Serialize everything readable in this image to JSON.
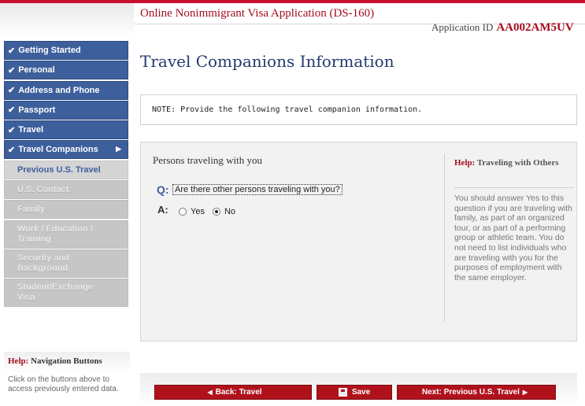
{
  "header": {
    "title": "Online Nonimmigrant Visa Application (DS-160)",
    "app_id_label": "Application ID",
    "app_id": "AA002AM5UV"
  },
  "page_title": "Travel Companions Information",
  "sidebar": {
    "items": [
      {
        "label": "Getting Started",
        "state": "done"
      },
      {
        "label": "Personal",
        "state": "done"
      },
      {
        "label": "Address and Phone",
        "state": "done"
      },
      {
        "label": "Passport",
        "state": "done"
      },
      {
        "label": "Travel",
        "state": "done"
      },
      {
        "label": "Travel Companions",
        "state": "active"
      },
      {
        "label": "Previous U.S. Travel",
        "state": "current"
      },
      {
        "label": "U.S. Contact",
        "state": "todo"
      },
      {
        "label": "Family",
        "state": "todo"
      },
      {
        "label": "Work / Education / Training",
        "state": "todo"
      },
      {
        "label": "Security and Background",
        "state": "todo"
      },
      {
        "label": "Student/Exchange Visa",
        "state": "todo"
      }
    ]
  },
  "help_nav": {
    "title_red": "Help:",
    "title": "Navigation Buttons",
    "text": "Click on the buttons above to access previously entered data."
  },
  "note": "NOTE: Provide the following travel companion information.",
  "form": {
    "section_title": "Persons traveling with you",
    "q_label": "Q:",
    "question": "Are there other persons traveling with you?",
    "a_label": "A:",
    "options": [
      "Yes",
      "No"
    ],
    "selected": "No"
  },
  "help_side": {
    "title_red": "Help:",
    "title": "Traveling with Others",
    "text": "You should answer Yes to this question if you are traveling with family, as part of an organized tour, or as part of a performing group or athletic team. You do not need to list individuals who are traveling with you for the purposes of employment with the same employer."
  },
  "buttons": {
    "back": "Back: Travel",
    "save": "Save",
    "next": "Next: Previous U.S. Travel"
  }
}
